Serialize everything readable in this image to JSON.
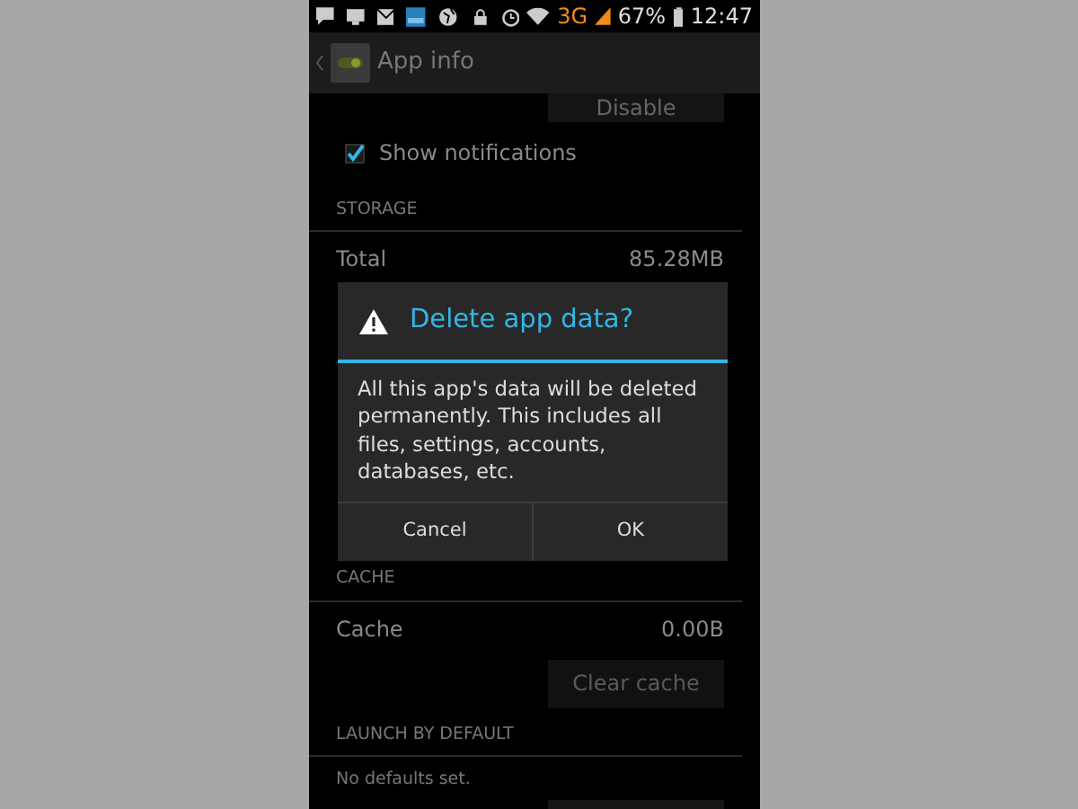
{
  "status_bar": {
    "network": "3G",
    "battery": "67%",
    "time": "12:47"
  },
  "action_bar": {
    "title": "App info"
  },
  "disable_button": {
    "label": "Disable"
  },
  "show_notifications": {
    "label": "Show notifications",
    "checked": true
  },
  "storage": {
    "header": "STORAGE",
    "rows": [
      {
        "label": "Total",
        "value": "85.28MB"
      }
    ]
  },
  "dialog": {
    "title": "Delete app data?",
    "message": "All this app's data will be deleted permanently. This includes all files, settings, accounts, databases, etc.",
    "buttons": [
      "Cancel",
      "OK"
    ]
  },
  "cache": {
    "header": "CACHE",
    "rows": [
      {
        "label": "Cache",
        "value": "0.00B"
      }
    ],
    "button": {
      "label": "Clear cache",
      "disabled": true
    }
  },
  "launch_by_default": {
    "header": "LAUNCH BY DEFAULT",
    "text": "No defaults set."
  }
}
